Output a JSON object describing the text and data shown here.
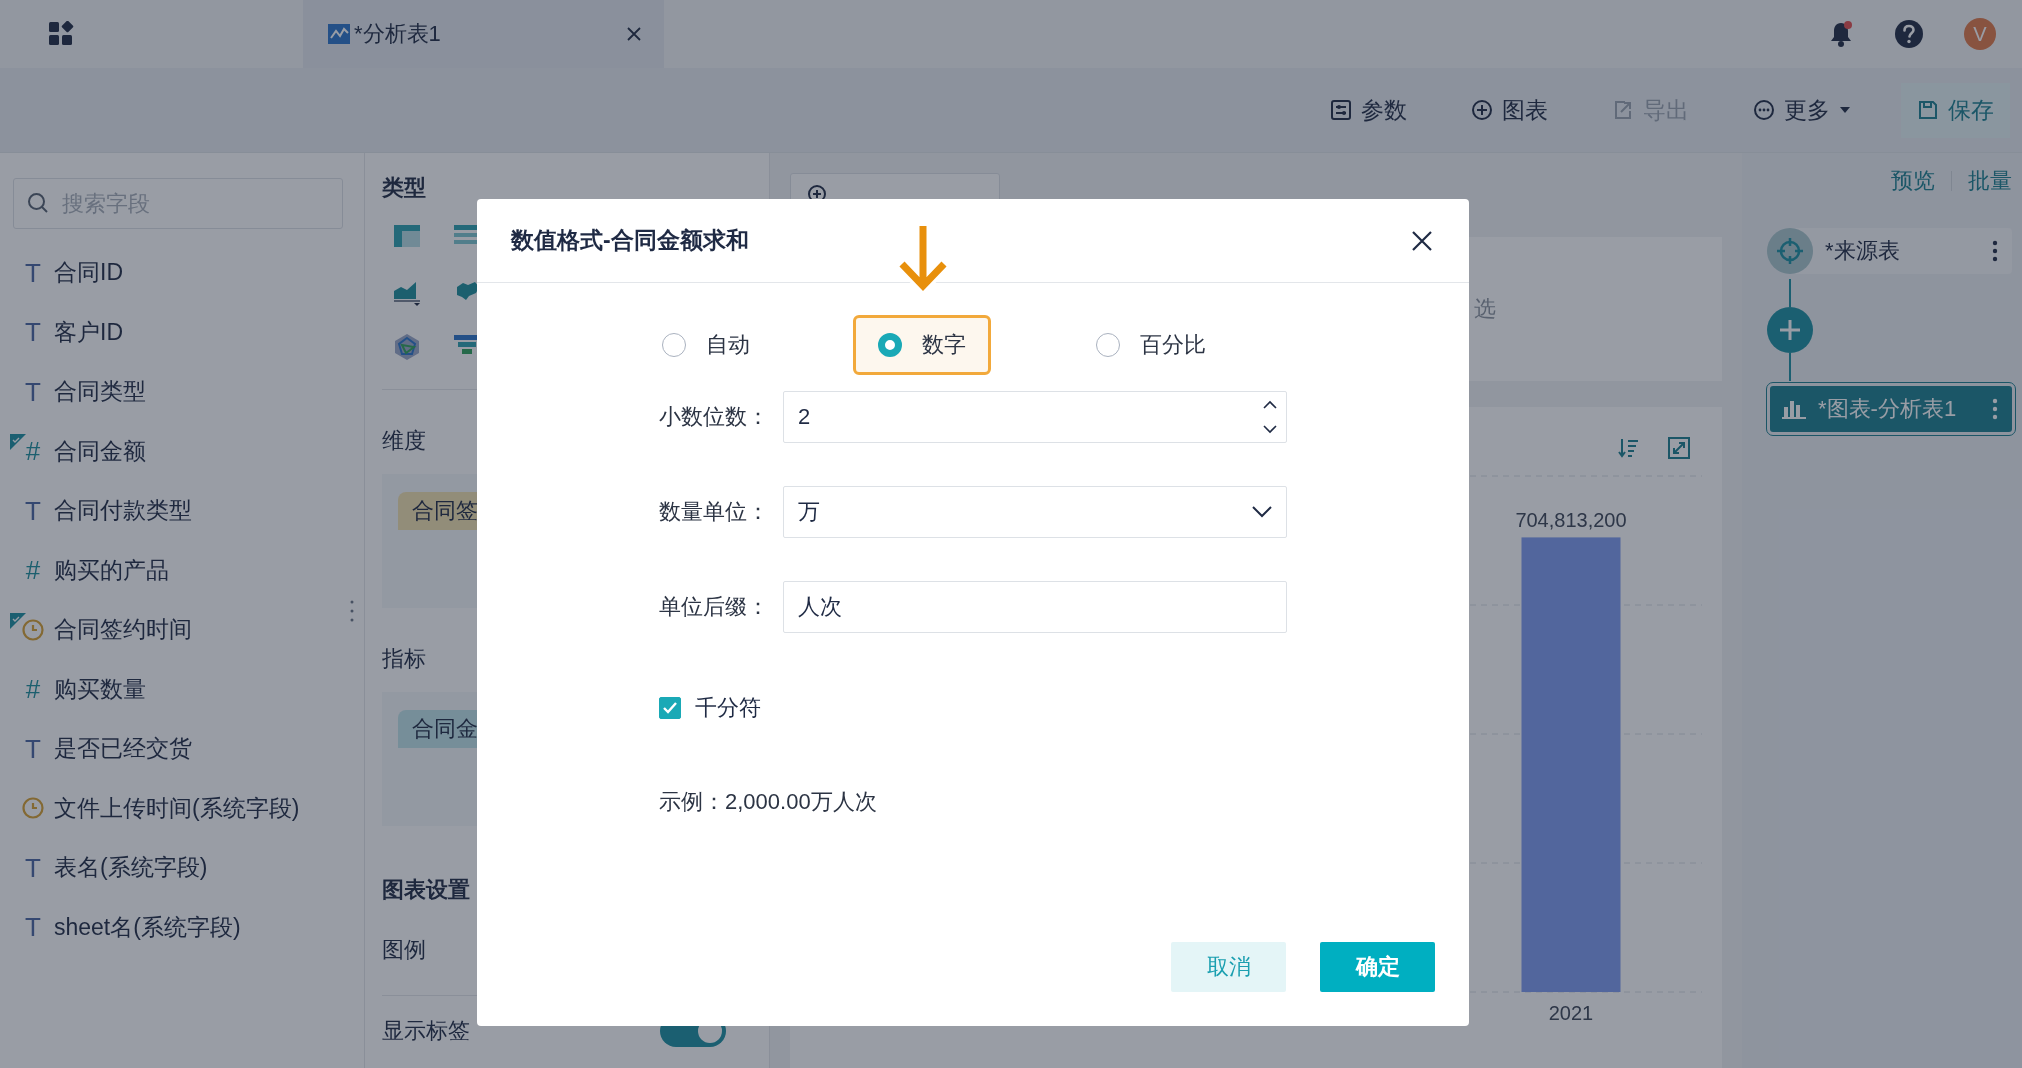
{
  "top_bar": {
    "tab": {
      "title": "*分析表1"
    },
    "avatar": "V",
    "notification": true
  },
  "toolbar": [
    {
      "label": "参数",
      "kind": "params",
      "disabled": false
    },
    {
      "label": "图表",
      "kind": "add",
      "disabled": false
    },
    {
      "label": "导出",
      "kind": "export",
      "disabled": true
    },
    {
      "label": "更多",
      "kind": "more",
      "disabled": false
    },
    {
      "label": "保存",
      "kind": "save",
      "disabled": false
    }
  ],
  "field_panel": {
    "search": {
      "placeholder": "搜索字段"
    },
    "fields": [
      {
        "name": "合同ID",
        "kind": "text",
        "glyph": "T",
        "in_use": false
      },
      {
        "name": "客户ID",
        "kind": "text",
        "glyph": "T",
        "in_use": false
      },
      {
        "name": "合同类型",
        "kind": "text",
        "glyph": "T",
        "in_use": false
      },
      {
        "name": "合同金额",
        "kind": "number",
        "glyph": "#",
        "in_use": true
      },
      {
        "name": "合同付款类型",
        "kind": "text",
        "glyph": "T",
        "in_use": false
      },
      {
        "name": "购买的产品",
        "kind": "number",
        "glyph": "#",
        "in_use": false
      },
      {
        "name": "合同签约时间",
        "kind": "date",
        "in_use": true
      },
      {
        "name": "购买数量",
        "kind": "number",
        "glyph": "#",
        "in_use": false
      },
      {
        "name": "是否已经交货",
        "kind": "text",
        "glyph": "T",
        "in_use": false
      },
      {
        "name": "文件上传时间(系统字段)",
        "kind": "date",
        "in_use": false
      },
      {
        "name": "表名(系统字段)",
        "kind": "text",
        "glyph": "T",
        "in_use": false
      },
      {
        "name": "sheet名(系统字段)",
        "kind": "text",
        "glyph": "T",
        "in_use": false
      }
    ]
  },
  "config_panel": {
    "type_heading": "类型",
    "dimension_heading": "维度",
    "dimension_chip": "合同签",
    "measure_heading": "指标",
    "measure_chip": "合同金",
    "settings_heading": "图表设置",
    "legend_label": "图例",
    "show_labels": {
      "label": "显示标签",
      "on": true
    }
  },
  "canvas": {
    "filter_hint": "选",
    "chart": {
      "chart_data": {
        "type": "bar",
        "categories": [
          "2021"
        ],
        "values": [
          704813200
        ],
        "ylim": [
          0,
          800000000
        ],
        "value_labels": [
          "704,813,200"
        ],
        "color": "#7f9cf0"
      }
    }
  },
  "flow_panel": {
    "links": [
      "预览",
      "批量"
    ],
    "nodes": [
      {
        "label": "*来源表",
        "kind": "source",
        "selected": false
      },
      {
        "label": "*图表-分析表1",
        "kind": "chart",
        "selected": true
      }
    ]
  },
  "dialog": {
    "title": "数值格式-合同金额求和",
    "formats": [
      {
        "label": "自动",
        "selected": false
      },
      {
        "label": "数字",
        "selected": true
      },
      {
        "label": "百分比",
        "selected": false
      }
    ],
    "decimals": {
      "label": "小数位数：",
      "value": "2"
    },
    "unit": {
      "label": "数量单位：",
      "value": "万"
    },
    "suffix": {
      "label": "单位后缀：",
      "value": "人次"
    },
    "thousands": {
      "label": "千分符",
      "checked": true
    },
    "example": "示例：2,000.00万人次",
    "buttons": [
      {
        "label": "取消",
        "kind": "secondary"
      },
      {
        "label": "确定",
        "kind": "primary"
      }
    ]
  }
}
